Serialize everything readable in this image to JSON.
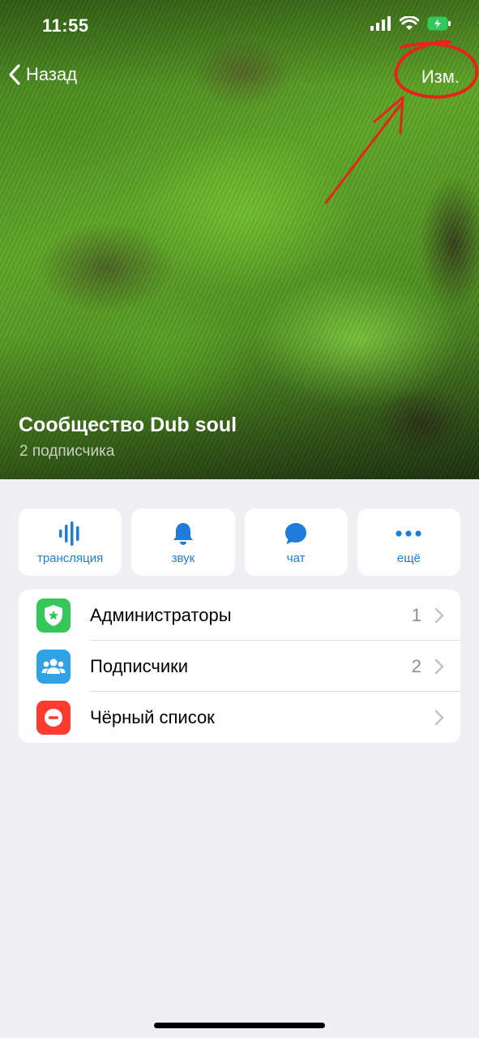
{
  "status_bar": {
    "time": "11:55"
  },
  "nav": {
    "back_label": "Назад",
    "edit_label": "Изм."
  },
  "channel": {
    "title": "Сообщество Dub soul",
    "subtitle": "2 подписчика"
  },
  "actions": [
    {
      "label": "трансляция",
      "icon": "live-stream-icon"
    },
    {
      "label": "звук",
      "icon": "bell-icon"
    },
    {
      "label": "чат",
      "icon": "chat-bubble-icon"
    },
    {
      "label": "ещё",
      "icon": "more-dots-icon"
    }
  ],
  "list": [
    {
      "label": "Администраторы",
      "count": "1",
      "icon": "admin-shield-icon",
      "color": "#34c759"
    },
    {
      "label": "Подписчики",
      "count": "2",
      "icon": "subscribers-group-icon",
      "color": "#30a3e6"
    },
    {
      "label": "Чёрный список",
      "count": "",
      "icon": "blocked-minus-icon",
      "color": "#ff3b30"
    }
  ],
  "colors": {
    "accent": "#1e7ddc",
    "annotation": "#e8231a",
    "background": "#efeff4"
  }
}
